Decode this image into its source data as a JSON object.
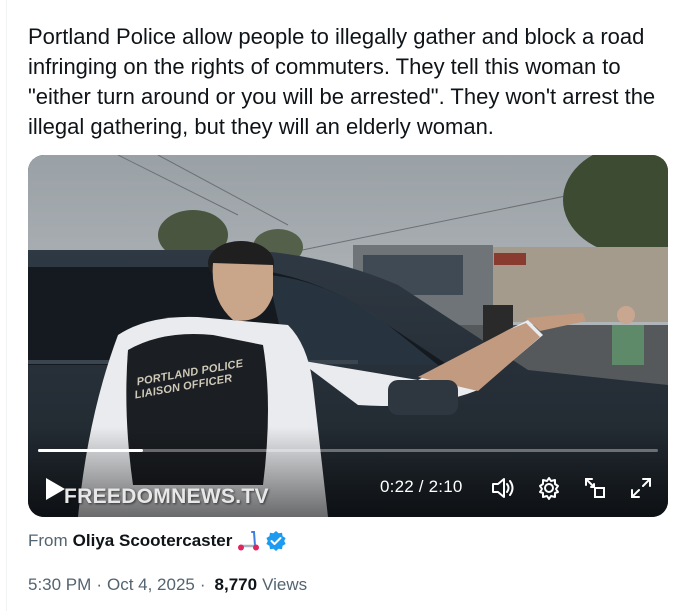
{
  "tweet": {
    "text": "Portland Police allow people to illegally gather and block a road infringing on the rights of commuters.  They tell this woman to \"either turn around or you will be arrested\".  They won't arrest the illegal gathering, but they will an elderly woman."
  },
  "video": {
    "watermark": "FREEDOMNEWS.TV",
    "vest_line1": "PORTLAND POLICE",
    "vest_line2": "LIAISON OFFICER",
    "elapsed": "0:22",
    "duration": "2:10",
    "time_display": "0:22 / 2:10",
    "progress_fraction": 0.169,
    "icons": [
      "play-icon",
      "volume-icon",
      "settings-gear-icon",
      "picture-in-picture-icon",
      "fullscreen-icon"
    ]
  },
  "attribution": {
    "from_label": "From",
    "author_name": "Oliya Scootercaster",
    "emoji": "scooter-icon",
    "verified_color": "#1d9bf0"
  },
  "meta": {
    "time": "5:30 PM",
    "date": "Oct 4, 2025",
    "separator": "·",
    "views_count": "8,770",
    "views_label": "Views"
  },
  "colors": {
    "text_primary": "#0f1419",
    "text_secondary": "#536471",
    "accent": "#1d9bf0"
  }
}
